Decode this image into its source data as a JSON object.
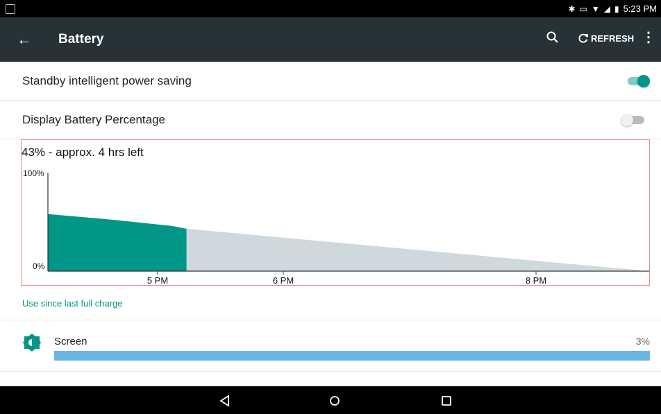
{
  "status_bar": {
    "time": "5:23 PM",
    "icons": [
      "image-icon",
      "bluetooth-icon",
      "vibrate-icon",
      "wifi-icon",
      "signal-icon",
      "battery-icon"
    ]
  },
  "app_bar": {
    "title": "Battery",
    "refresh_label": "REFRESH",
    "back_icon": "back-arrow-icon",
    "search_icon": "search-icon",
    "overflow_icon": "more-vert-icon"
  },
  "settings": {
    "standby": {
      "label": "Standby intelligent power saving",
      "enabled": true
    },
    "percentage": {
      "label": "Display Battery Percentage",
      "enabled": false
    }
  },
  "chart_data": {
    "type": "area",
    "title": "43% - approx. 4 hrs left",
    "y_tick_labels": [
      "100%",
      "0%"
    ],
    "x_tick_labels": [
      "5 PM",
      "6 PM",
      "8 PM"
    ],
    "ylim": [
      0,
      100
    ],
    "series": [
      {
        "kind": "history",
        "color": "#009688",
        "points": [
          [
            "4:09 PM",
            58
          ],
          [
            "4:45 PM",
            52
          ],
          [
            "5:15 PM",
            46
          ],
          [
            "5:23 PM",
            43
          ]
        ]
      },
      {
        "kind": "prediction",
        "color": "#cfd8dc",
        "points": [
          [
            "5:23 PM",
            43
          ],
          [
            "9:30 PM",
            0
          ]
        ]
      }
    ]
  },
  "usage": {
    "section_label": "Use since last full charge",
    "items": [
      {
        "label": "Screen",
        "percent_text": "3%",
        "bar_fraction": 1.0,
        "icon": "brightness-icon",
        "color": "#6ab6e2"
      }
    ]
  },
  "nav_bar": {
    "back": "nav-back-icon",
    "home": "nav-home-icon",
    "recents": "nav-recents-icon"
  },
  "colors": {
    "accent": "#009688",
    "app_bar": "#263238",
    "chart_border": "#f0898b"
  }
}
